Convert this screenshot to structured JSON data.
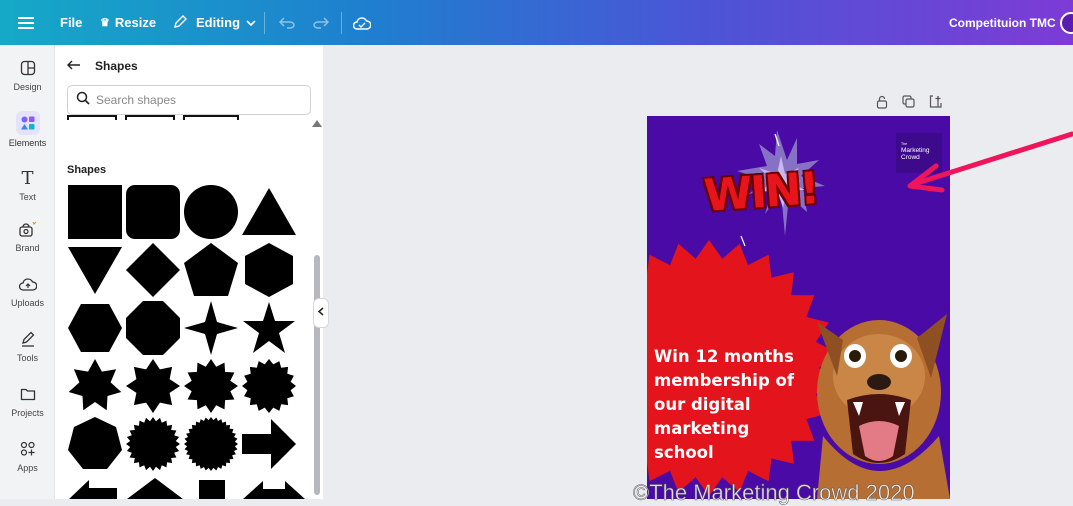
{
  "topbar": {
    "file_label": "File",
    "resize_label": "Resize",
    "editing_label": "Editing",
    "project_title": "Competituion TMC"
  },
  "rail": {
    "items": [
      {
        "label": "Design",
        "icon": "layout-icon"
      },
      {
        "label": "Elements",
        "icon": "elements-icon"
      },
      {
        "label": "Text",
        "icon": "text-icon"
      },
      {
        "label": "Brand",
        "icon": "brand-icon"
      },
      {
        "label": "Uploads",
        "icon": "upload-cloud-icon"
      },
      {
        "label": "Tools",
        "icon": "pen-icon"
      },
      {
        "label": "Projects",
        "icon": "folder-icon"
      },
      {
        "label": "Apps",
        "icon": "apps-icon"
      }
    ]
  },
  "panel": {
    "title": "Shapes",
    "search_placeholder": "Search shapes",
    "section_label": "Shapes",
    "shapes": [
      "square",
      "rounded-square",
      "circle",
      "triangle",
      "triangle-down",
      "diamond",
      "pentagon",
      "hexagon",
      "hexagon-flat",
      "octagon",
      "star-4",
      "star-5",
      "star-7",
      "star-8",
      "star-12",
      "star-16",
      "heptagon",
      "starburst-24",
      "starburst-32",
      "arrow-right"
    ]
  },
  "canvas": {
    "logo_line1": "The",
    "logo_line2": "Marketing",
    "logo_line3": "Crowd",
    "win_text": "WIN!",
    "promo_text": "Win 12 months\nmembership of\nour digital\nmarketing\nschool",
    "watermark": "©The Marketing Crowd 2020"
  },
  "colors": {
    "poster_bg": "#4a0aa5",
    "burst_red": "#e3141b",
    "arrow_pink": "#f0145a"
  }
}
